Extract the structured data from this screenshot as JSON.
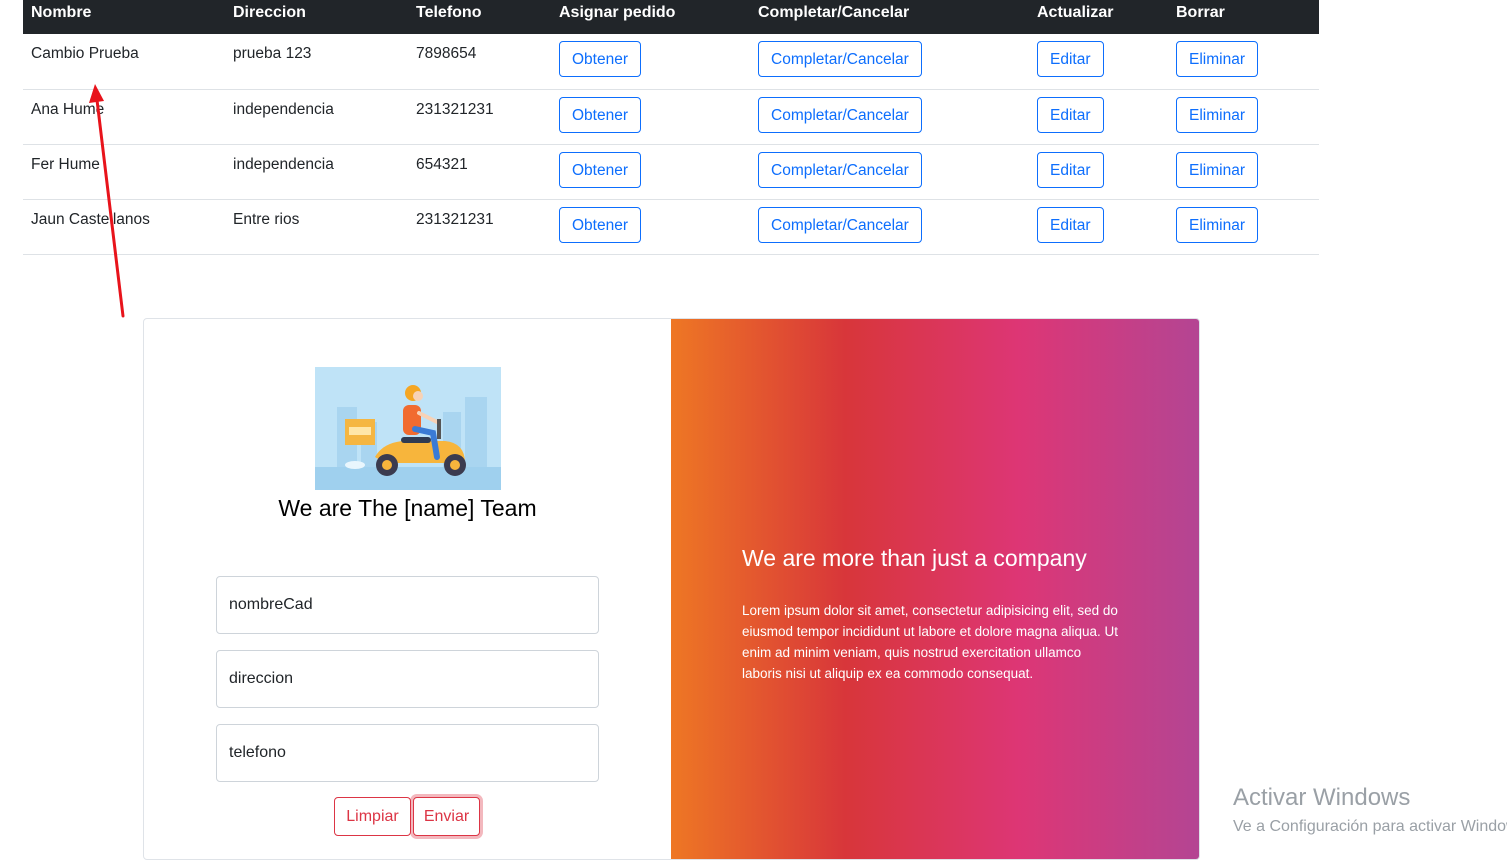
{
  "table": {
    "headers": [
      "Nombre",
      "Direccion",
      "Telefono",
      "Asignar pedido",
      "Completar/Cancelar",
      "Actualizar",
      "Borrar"
    ],
    "rows": [
      {
        "nombre": "Cambio Prueba",
        "direccion": "prueba 123",
        "telefono": "7898654",
        "obtener": "Obtener",
        "completar": "Completar/Cancelar",
        "editar": "Editar",
        "eliminar": "Eliminar"
      },
      {
        "nombre": "Ana Hume",
        "direccion": "independencia",
        "telefono": "231321231",
        "obtener": "Obtener",
        "completar": "Completar/Cancelar",
        "editar": "Editar",
        "eliminar": "Eliminar"
      },
      {
        "nombre": "Fer Hume",
        "direccion": "independencia",
        "telefono": "654321",
        "obtener": "Obtener",
        "completar": "Completar/Cancelar",
        "editar": "Editar",
        "eliminar": "Eliminar"
      },
      {
        "nombre": "Jaun Castellanos",
        "direccion": "Entre rios",
        "telefono": "231321231",
        "obtener": "Obtener",
        "completar": "Completar/Cancelar",
        "editar": "Editar",
        "eliminar": "Eliminar"
      }
    ]
  },
  "form": {
    "team_title": "We are The [name] Team",
    "nombre_value": "nombreCad",
    "direccion_value": "direccion",
    "telefono_value": "telefono",
    "limpiar_label": "Limpiar",
    "enviar_label": "Enviar"
  },
  "promo": {
    "title": "We are more than just a company",
    "text": "Lorem ipsum dolor sit amet, consectetur adipisicing elit, sed do eiusmod tempor incididunt ut labore et dolore magna aliqua. Ut enim ad minim veniam, quis nostrud exercitation ullamco laboris nisi ut aliquip ex ea commodo consequat."
  },
  "watermark": {
    "title": "Activar Windows",
    "subtitle": "Ve a Configuración para activar Windows."
  },
  "colors": {
    "primary": "#0d6efd",
    "danger": "#dc3545",
    "header_bg": "#212529",
    "gradient": [
      "#ee7724",
      "#d8363a",
      "#dd3675",
      "#b44593"
    ]
  }
}
